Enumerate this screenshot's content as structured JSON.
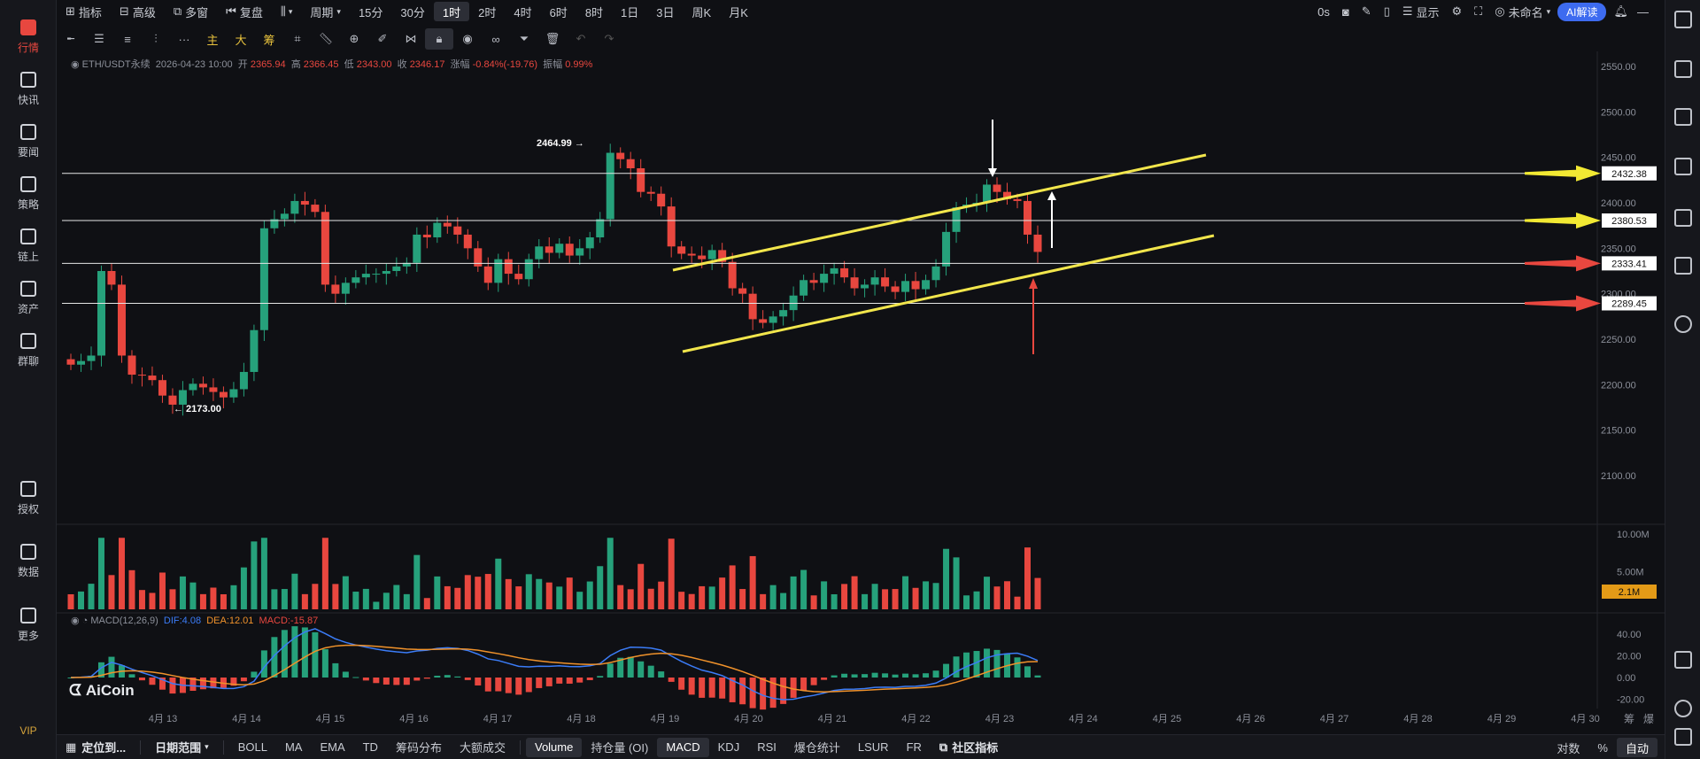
{
  "leftnav": {
    "items": [
      {
        "label": "行情",
        "icon": "market-icon"
      },
      {
        "label": "快讯",
        "icon": "news-flash-icon"
      },
      {
        "label": "要闻",
        "icon": "headlines-icon"
      },
      {
        "label": "策略",
        "icon": "robot-icon"
      },
      {
        "label": "链上",
        "icon": "chain-icon"
      },
      {
        "label": "资产",
        "icon": "wallet-icon"
      },
      {
        "label": "群聊",
        "icon": "chat-icon"
      },
      {
        "label": "授权",
        "icon": "key-icon"
      },
      {
        "label": "数据",
        "icon": "data-icon"
      },
      {
        "label": "更多",
        "icon": "grid-icon"
      }
    ],
    "vip": "VIP"
  },
  "topbar": {
    "items": [
      "指标",
      "高级",
      "多窗",
      "复盘",
      "周期",
      "15分",
      "30分",
      "1时",
      "2时",
      "4时",
      "6时",
      "8时",
      "1日",
      "3日",
      "周K",
      "月K"
    ],
    "active": "1时",
    "right": {
      "timer": "0s",
      "display": "显示",
      "layout": "未命名",
      "ai": "AI解读"
    }
  },
  "toolbar": {
    "labels": [
      "主",
      "大",
      "筹"
    ],
    "more": "···"
  },
  "legend": {
    "symbol": "ETH/USDT永续",
    "datetime": "2026-04-23 10:00",
    "open_label": "开",
    "open": "2365.94",
    "high_label": "高",
    "high": "2366.45",
    "low_label": "低",
    "low": "2343.00",
    "close_label": "收",
    "close": "2346.17",
    "change_label": "涨幅",
    "change": "-0.84%(-19.76)",
    "amp_label": "振幅",
    "amp": "0.99%"
  },
  "macd_legend": {
    "name": "MACD(12,26,9)",
    "dif": "DIF:4.08",
    "dea": "DEA:12.01",
    "macd": "MACD:-15.87"
  },
  "logo": "AiCoin",
  "chart_data": {
    "type": "candlestick",
    "y_ticks": [
      "2550.00",
      "2500.00",
      "2450.00",
      "2400.00",
      "2350.00",
      "2300.00",
      "2250.00",
      "2200.00",
      "2150.00",
      "2100.00"
    ],
    "x_ticks": [
      "4月 13",
      "4月 14",
      "4月 15",
      "4月 16",
      "4月 17",
      "4月 18",
      "4月 19",
      "4月 20",
      "4月 21",
      "4月 22",
      "4月 23",
      "4月 24",
      "4月 25",
      "4月 26",
      "4月 27",
      "4月 28",
      "4月 29",
      "4月 30"
    ],
    "volume_ticks": [
      "10.00M",
      "5.00M"
    ],
    "volume_last": "2.1M",
    "macd_ticks": [
      "40.00",
      "20.00",
      "0.00",
      "-20.00"
    ],
    "high_marker": "2464.99",
    "low_marker": "2173.00",
    "levels": [
      "2432.38",
      "2380.53",
      "2333.41",
      "2289.45"
    ],
    "level_arrow_colors": [
      "#f2e933",
      "#f2e933",
      "#e8473f",
      "#e8473f"
    ],
    "trend_color": "#f2e64c",
    "up_color": "#26a17b",
    "down_color": "#e8473f",
    "close_series": [
      2222,
      2226,
      2232,
      2325,
      2310,
      2232,
      2211,
      2210,
      2205,
      2188,
      2178,
      2194,
      2201,
      2197,
      2192,
      2186,
      2195,
      2214,
      2260,
      2372,
      2382,
      2388,
      2402,
      2398,
      2390,
      2310,
      2300,
      2312,
      2318,
      2322,
      2322,
      2325,
      2330,
      2334,
      2365,
      2362,
      2378,
      2374,
      2365,
      2350,
      2330,
      2312,
      2338,
      2322,
      2316,
      2338,
      2352,
      2345,
      2355,
      2342,
      2350,
      2362,
      2382,
      2455,
      2448,
      2438,
      2412,
      2410,
      2396,
      2352,
      2344,
      2342,
      2338,
      2348,
      2335,
      2306,
      2300,
      2272,
      2268,
      2275,
      2282,
      2298,
      2315,
      2312,
      2322,
      2328,
      2318,
      2306,
      2310,
      2318,
      2308,
      2302,
      2314,
      2305,
      2315,
      2330,
      2368,
      2395,
      2398,
      2400,
      2420,
      2412,
      2404,
      2402,
      2365,
      2346
    ]
  },
  "bottombar": {
    "locate": "定位到...",
    "range": "日期范围",
    "indicators": [
      "BOLL",
      "MA",
      "EMA",
      "TD",
      "筹码分布",
      "大额成交"
    ],
    "tabs": [
      "Volume",
      "持仓量 (OI)",
      "MACD",
      "KDJ",
      "RSI",
      "爆仓统计",
      "LSUR",
      "FR"
    ],
    "community": "社区指标",
    "right": [
      "对数",
      "%",
      "自动"
    ]
  },
  "side_labels": {
    "chip": "筹",
    "burst": "爆"
  }
}
